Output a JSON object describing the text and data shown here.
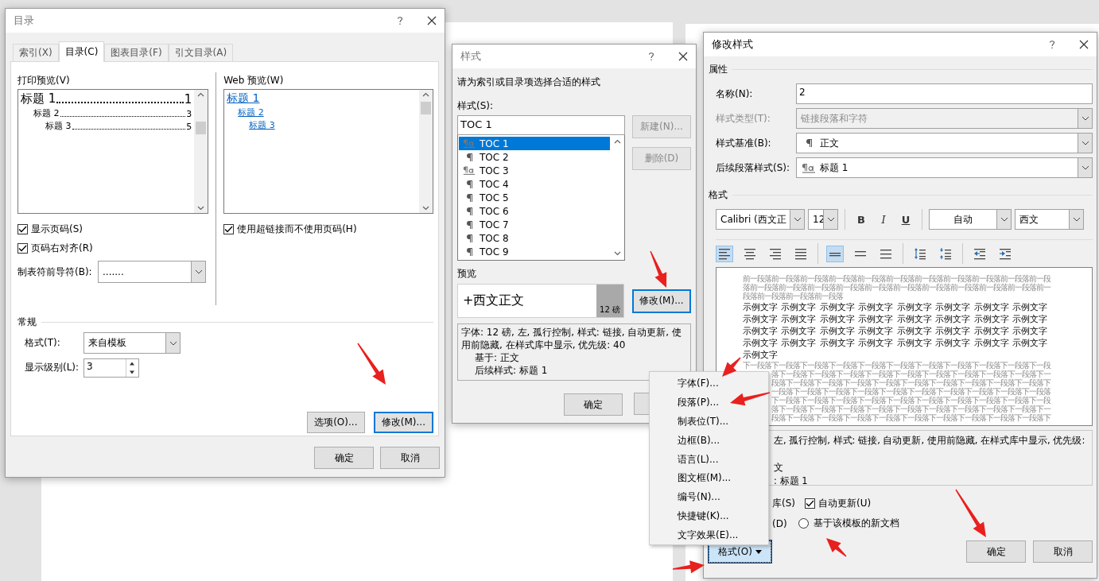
{
  "toc_dialog": {
    "title": "目录",
    "tabs": [
      {
        "label": "索引(X)",
        "selected": false
      },
      {
        "label": "目录(C)",
        "selected": true
      },
      {
        "label": "图表目录(F)",
        "selected": false
      },
      {
        "label": "引文目录(A)",
        "selected": false
      }
    ],
    "print_preview": {
      "label": "打印预览(V)",
      "entries": [
        {
          "text": "标题 1",
          "page": "1",
          "children": [
            {
              "text": "标题 2",
              "page": "3",
              "children": [
                {
                  "text": "标题 3",
                  "page": "5"
                }
              ]
            }
          ]
        }
      ]
    },
    "web_preview": {
      "label": "Web 预览(W)",
      "entries": [
        {
          "text": "标题 1",
          "children": [
            {
              "text": "标题 2",
              "children": [
                {
                  "text": "标题 3"
                }
              ]
            }
          ]
        }
      ]
    },
    "show_page_numbers": {
      "label": "显示页码(S)",
      "checked": true
    },
    "right_align": {
      "label": "页码右对齐(R)",
      "checked": true
    },
    "tab_leader": {
      "label": "制表符前导符(B):",
      "value": "......."
    },
    "use_hyperlinks": {
      "label": "使用超链接而不使用页码(H)",
      "checked": true
    },
    "general": {
      "heading": "常规",
      "format": {
        "label": "格式(T):",
        "value": "来自模板"
      },
      "show_levels": {
        "label": "显示级别(L):",
        "value": "3"
      }
    },
    "panel_buttons": [
      {
        "label": "选项(O)...",
        "focused": false
      },
      {
        "label": "修改(M)...",
        "focused": true
      }
    ],
    "buttons": [
      {
        "label": "确定"
      },
      {
        "label": "取消"
      }
    ]
  },
  "style_dialog": {
    "title": "样式",
    "prompt": "请为索引或目录项选择合适的样式",
    "styles_label": "样式(S):",
    "style_name": "TOC 1",
    "styles": [
      {
        "name": "TOC 1",
        "kind": "linked",
        "selected": true
      },
      {
        "name": "TOC 2",
        "kind": "paragraph",
        "selected": false
      },
      {
        "name": "TOC 3",
        "kind": "linked",
        "selected": false
      },
      {
        "name": "TOC 4",
        "kind": "paragraph",
        "selected": false
      },
      {
        "name": "TOC 5",
        "kind": "paragraph",
        "selected": false
      },
      {
        "name": "TOC 6",
        "kind": "paragraph",
        "selected": false
      },
      {
        "name": "TOC 7",
        "kind": "paragraph",
        "selected": false
      },
      {
        "name": "TOC 8",
        "kind": "paragraph",
        "selected": false
      },
      {
        "name": "TOC 9",
        "kind": "paragraph",
        "selected": false
      }
    ],
    "side_buttons": [
      {
        "label": "新建(N)...",
        "disabled": true
      },
      {
        "label": "删除(D)",
        "disabled": true
      }
    ],
    "preview_label": "预览",
    "preview_text": "+西文正文",
    "preview_size": "12 磅",
    "modify_button": {
      "label": "修改(M)...",
      "focused": true
    },
    "description": [
      "字体: 12 磅, 左, 孤行控制, 样式: 链接, 自动更新, 使用前隐藏, 在样式库中显示, 优先级: 40",
      "基于: 正文",
      "后续样式: 标题 1"
    ],
    "ok_button": "确定"
  },
  "modify_dialog": {
    "title": "修改样式",
    "properties": {
      "heading": "属性",
      "fields": [
        {
          "label": "名称(N):",
          "value": "2",
          "kind": "text",
          "disabled": false
        },
        {
          "label": "样式类型(T):",
          "value": "链接段落和字符",
          "kind": "dropdown",
          "disabled": true
        },
        {
          "label": "样式基准(B):",
          "value": "正文",
          "kind": "dropdown",
          "disabled": false,
          "icon": {
            "kind": "paragraph"
          }
        },
        {
          "label": "后续段落样式(S):",
          "value": "标题 1",
          "kind": "dropdown",
          "disabled": false,
          "icon": {
            "kind": "linked"
          }
        }
      ]
    },
    "format": {
      "heading": "格式",
      "font": "Calibri (西文正",
      "size": "12",
      "char_buttons": [
        {
          "label": "B",
          "kind": "bold"
        },
        {
          "label": "I",
          "kind": "italic"
        },
        {
          "label": "U",
          "kind": "underline"
        }
      ],
      "font_color": "自动",
      "script": "西文",
      "alignment": [
        {
          "kind": "left",
          "selected": true
        },
        {
          "kind": "center",
          "selected": false
        },
        {
          "kind": "right",
          "selected": false
        },
        {
          "kind": "justify",
          "selected": false
        }
      ],
      "line_spacing": [
        {
          "kind": "single",
          "selected": true
        },
        {
          "kind": "one_half",
          "selected": false
        },
        {
          "kind": "double",
          "selected": false
        }
      ],
      "paragraph_spacing": [
        {
          "kind": "increase"
        },
        {
          "kind": "decrease"
        }
      ],
      "indent": [
        {
          "kind": "decrease"
        },
        {
          "kind": "increase"
        }
      ]
    },
    "preview": {
      "before": [
        "前一段落前一段落前一段落前一段落前一段落前一段落前一段落前一段落前一段落前一段落前一段",
        "落前一段落前一段落前一段落前一段落前一段落前一段落前一段落前一段落前一段落前一段落前一",
        "段落前一段落前一段落前一段落"
      ],
      "sample": [
        "示例文字 示例文字 示例文字 示例文字 示例文字 示例文字 示例文字 示例文字",
        "示例文字 示例文字 示例文字 示例文字 示例文字 示例文字 示例文字 示例文字",
        "示例文字 示例文字 示例文字 示例文字 示例文字 示例文字 示例文字 示例文字",
        "示例文字 示例文字 示例文字 示例文字 示例文字 示例文字 示例文字 示例文字",
        "示例文字"
      ],
      "after": [
        "下一段落下一段落下一段落下一段落下一段落下一段落下一段落下一段落下一段落下一段落下一段",
        "落下一段落下一段落下一段落下一段落下一段落下一段落下一段落下一段落下一段落下一",
        "段落下一段落下一段落下一段落下一段落下一段落下一段落下一段落下一段落下一段落下",
        "一段落下一段落下一段落下一段落下一段落下一段落下一段落下一段落下一段落下一段落",
        "下一段落下一段落下一段落下一段落下一段落下一段落下一段落下一段落下一段落下一段",
        "落下一段落下一段落下一段落下一段落下一段落下一段落下一段落下一段落下一段落下一",
        "段落下一段落下一段落下一段落下一段落下一段落下一段落下一段落下一段落下一段落下"
      ]
    },
    "description": [
      "左, 孤行控制, 样式: 链接, 自动更新, 使用前隐藏, 在样式库中显示, 优先级:",
      "文",
      ": 标题 1"
    ],
    "gallery_option": "库(S)",
    "auto_update": {
      "label": "自动更新(U)",
      "checked": true
    },
    "document_option": "(D)",
    "template_option": {
      "label": "基于该模板的新文档",
      "selected": false
    },
    "format_button": "格式(O)",
    "buttons": [
      {
        "label": "确定"
      },
      {
        "label": "取消"
      }
    ]
  },
  "format_menu": {
    "items": [
      "字体(F)...",
      "段落(P)...",
      "制表位(T)...",
      "边框(B)...",
      "语言(L)...",
      "图文框(M)...",
      "编号(N)...",
      "快捷键(K)...",
      "文字效果(E)..."
    ]
  }
}
